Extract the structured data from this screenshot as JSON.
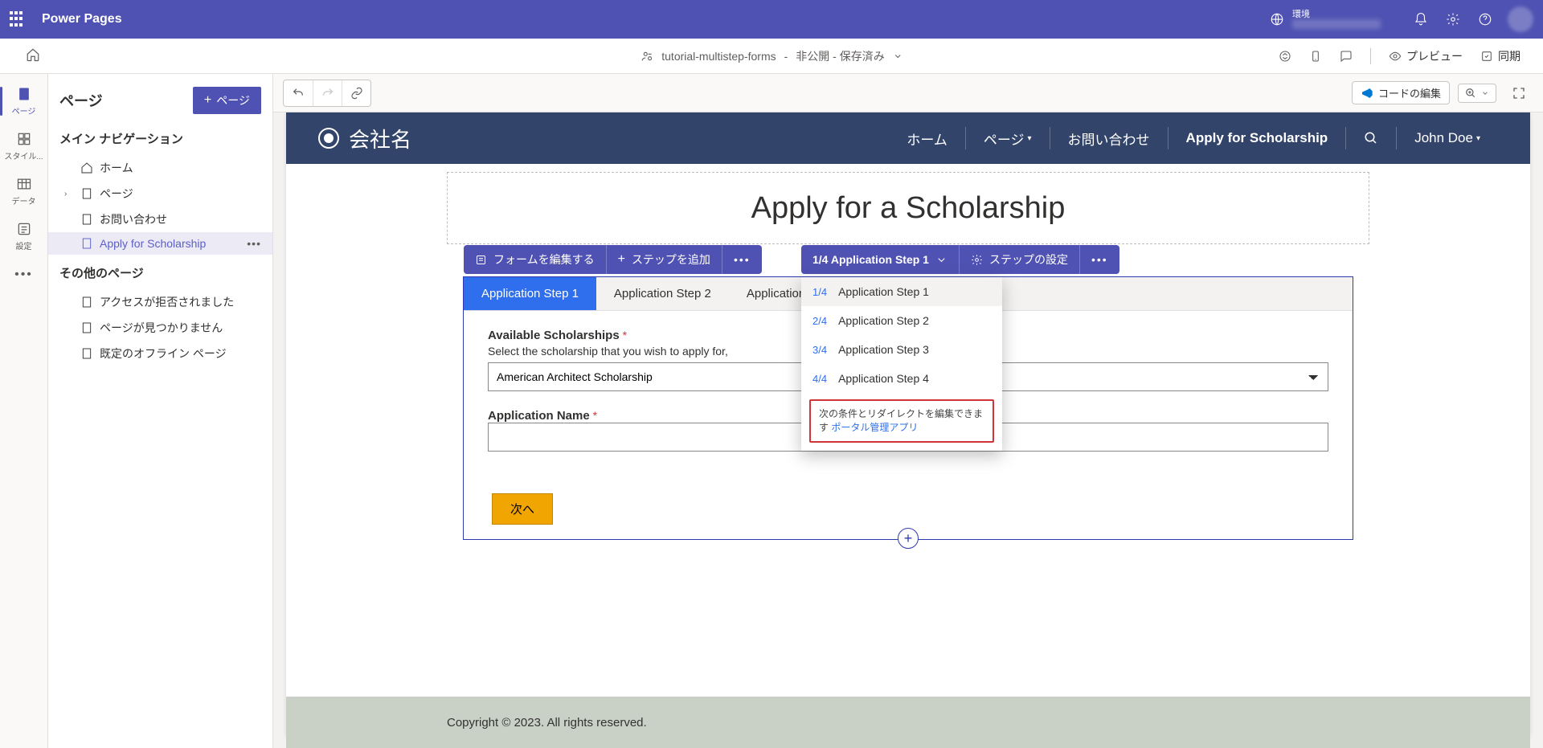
{
  "header": {
    "brand": "Power Pages",
    "env_label": "環境"
  },
  "subheader": {
    "site_name": "tutorial-multistep-forms",
    "status": "非公開 - 保存済み",
    "preview": "プレビュー",
    "sync": "同期"
  },
  "rail": {
    "pages": "ページ",
    "style": "スタイル...",
    "data": "データ",
    "settings": "設定"
  },
  "sidepanel": {
    "title": "ページ",
    "add_page": "ページ",
    "section_main": "メイン ナビゲーション",
    "section_other": "その他のページ",
    "nav": {
      "home": "ホーム",
      "pages": "ページ",
      "contact": "お問い合わせ",
      "apply": "Apply for Scholarship"
    },
    "other": {
      "access_denied": "アクセスが拒否されました",
      "not_found": "ページが見つかりません",
      "offline": "既定のオフライン ページ"
    }
  },
  "toolbar": {
    "edit_code": "コードの編集"
  },
  "site": {
    "company": "会社名",
    "nav_home": "ホーム",
    "nav_pages": "ページ",
    "nav_contact": "お問い合わせ",
    "nav_apply": "Apply for Scholarship",
    "user": "John Doe"
  },
  "page": {
    "heading": "Apply for a Scholarship"
  },
  "formbar": {
    "edit_form": "フォームを編集する",
    "add_step": "ステップを追加",
    "current_step": "1/4 Application Step 1",
    "step_settings": "ステップの設定"
  },
  "tabs": {
    "t1": "Application Step 1",
    "t2": "Application Step 2",
    "t3": "Application Step 3"
  },
  "step_dropdown": {
    "opts": [
      {
        "num": "1/4",
        "label": "Application Step 1"
      },
      {
        "num": "2/4",
        "label": "Application Step 2"
      },
      {
        "num": "3/4",
        "label": "Application Step 3"
      },
      {
        "num": "4/4",
        "label": "Application Step 4"
      }
    ],
    "note_text": "次の条件とリダイレクトを編集できます ",
    "note_link": "ポータル管理アプリ"
  },
  "form": {
    "scholarship_label": "Available Scholarships",
    "scholarship_help": "Select the scholarship that you wish to apply for,",
    "scholarship_value": "American Architect Scholarship",
    "appname_label": "Application Name",
    "next": "次へ"
  },
  "footer": {
    "copyright": "Copyright © 2023. All rights reserved."
  }
}
